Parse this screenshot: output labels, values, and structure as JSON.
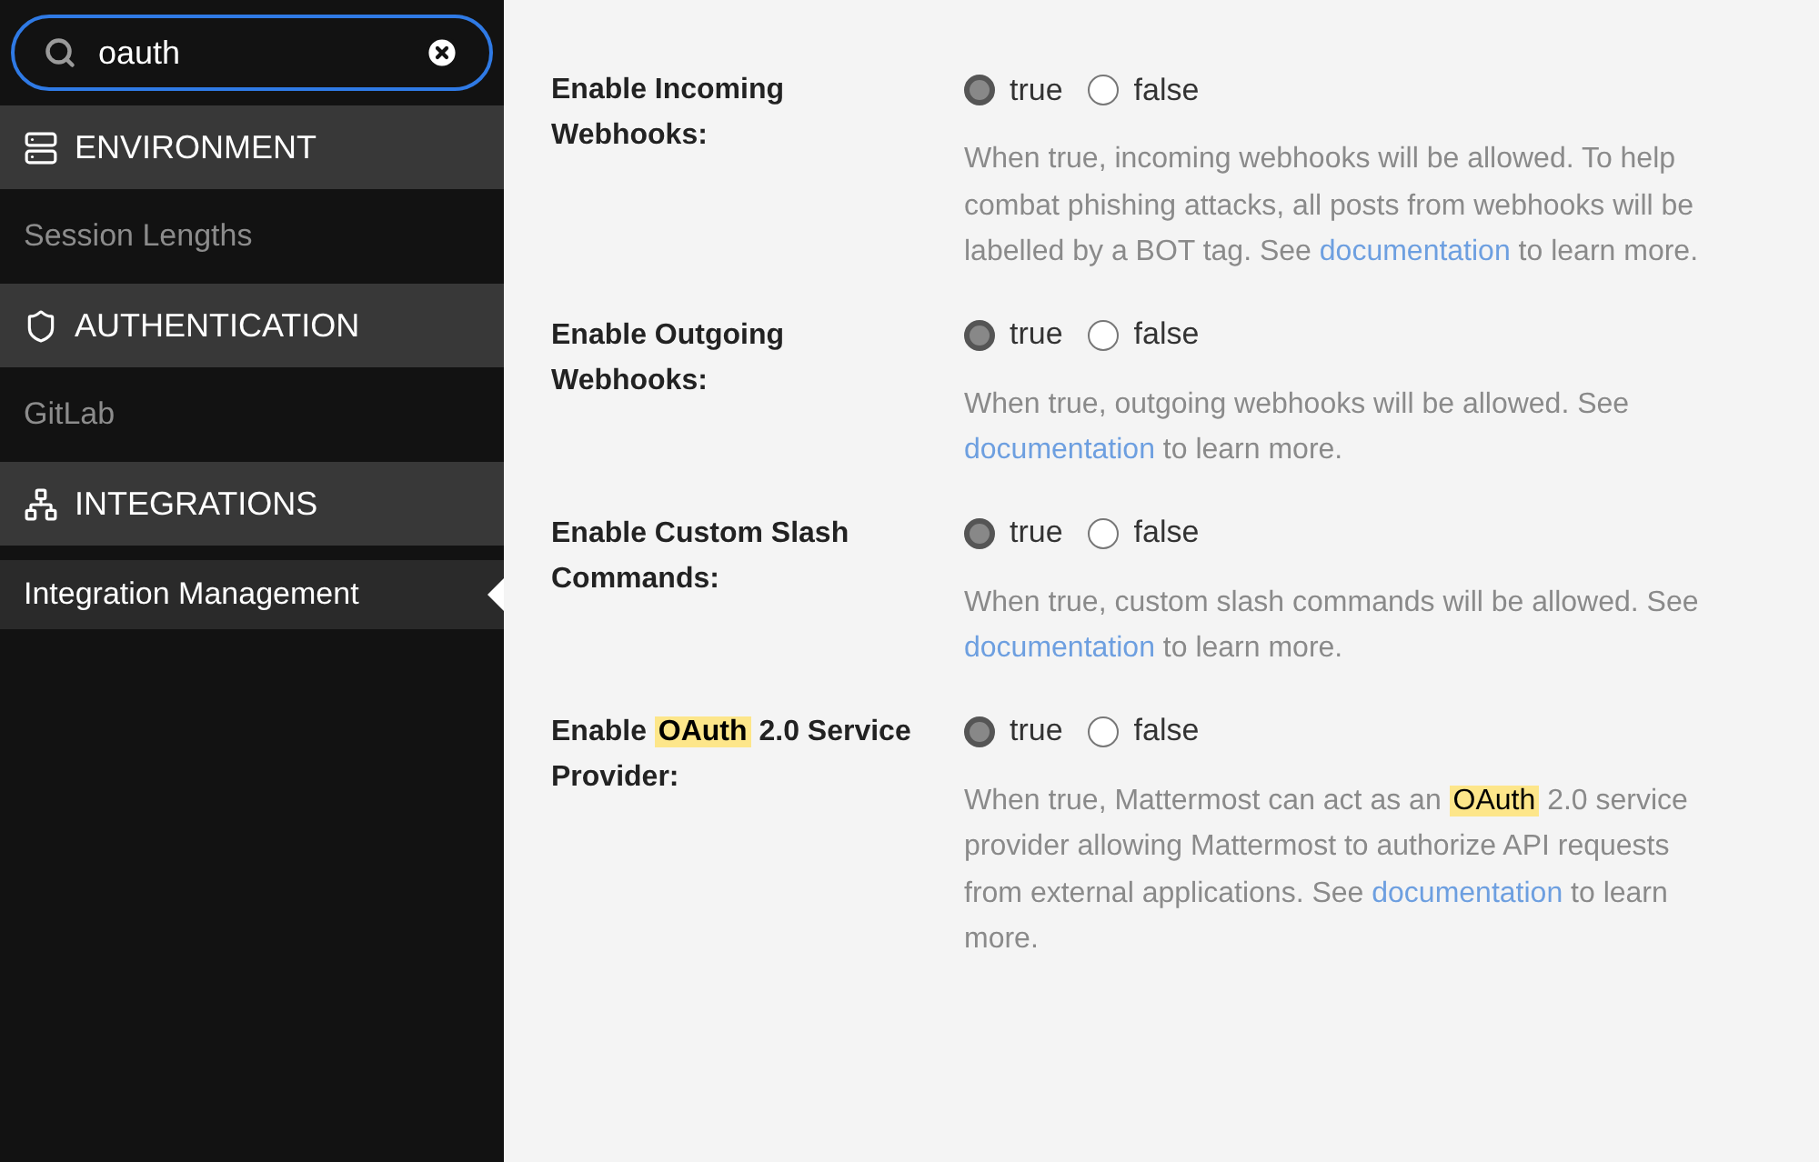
{
  "search": {
    "value": "oauth"
  },
  "sidebar": {
    "sections": [
      {
        "kind": "server",
        "title": "ENVIRONMENT",
        "items": [
          {
            "label": "Session Lengths",
            "selected": false
          }
        ]
      },
      {
        "kind": "shield",
        "title": "AUTHENTICATION",
        "items": [
          {
            "label": "GitLab",
            "selected": false
          }
        ]
      },
      {
        "kind": "sitemap",
        "title": "INTEGRATIONS",
        "items": [
          {
            "label": "Integration Management",
            "selected": true
          }
        ]
      }
    ]
  },
  "settings": [
    {
      "label": [
        {
          "kind": "text",
          "text": "Enable Incoming Webhooks:"
        }
      ],
      "options": [
        {
          "label": "true",
          "selected": true
        },
        {
          "label": "false",
          "selected": false
        }
      ],
      "help": [
        {
          "kind": "text",
          "text": "When true, incoming webhooks will be allowed. To help combat phishing attacks, all posts from webhooks will be labelled by a BOT tag. See "
        },
        {
          "kind": "link",
          "text": "documentation"
        },
        {
          "kind": "text",
          "text": " to learn more."
        }
      ]
    },
    {
      "label": [
        {
          "kind": "text",
          "text": "Enable Outgoing Webhooks:"
        }
      ],
      "options": [
        {
          "label": "true",
          "selected": true
        },
        {
          "label": "false",
          "selected": false
        }
      ],
      "help": [
        {
          "kind": "text",
          "text": "When true, outgoing webhooks will be allowed. See "
        },
        {
          "kind": "link",
          "text": "documentation"
        },
        {
          "kind": "text",
          "text": " to learn more."
        }
      ]
    },
    {
      "label": [
        {
          "kind": "text",
          "text": "Enable Custom Slash Commands:"
        }
      ],
      "options": [
        {
          "label": "true",
          "selected": true
        },
        {
          "label": "false",
          "selected": false
        }
      ],
      "help": [
        {
          "kind": "text",
          "text": "When true, custom slash commands will be allowed. See "
        },
        {
          "kind": "link",
          "text": "documentation"
        },
        {
          "kind": "text",
          "text": " to learn more."
        }
      ]
    },
    {
      "label": [
        {
          "kind": "text",
          "text": "Enable "
        },
        {
          "kind": "highlight",
          "text": "OAuth"
        },
        {
          "kind": "text",
          "text": " 2.0 Service Provider:"
        }
      ],
      "options": [
        {
          "label": "true",
          "selected": true
        },
        {
          "label": "false",
          "selected": false
        }
      ],
      "help": [
        {
          "kind": "text",
          "text": "When true, Mattermost can act as an "
        },
        {
          "kind": "highlight",
          "text": "OAuth"
        },
        {
          "kind": "text",
          "text": " 2.0 service provider allowing Mattermost to authorize API requests from external applications. See "
        },
        {
          "kind": "link",
          "text": "documentation"
        },
        {
          "kind": "text",
          "text": " to learn more."
        }
      ]
    }
  ]
}
